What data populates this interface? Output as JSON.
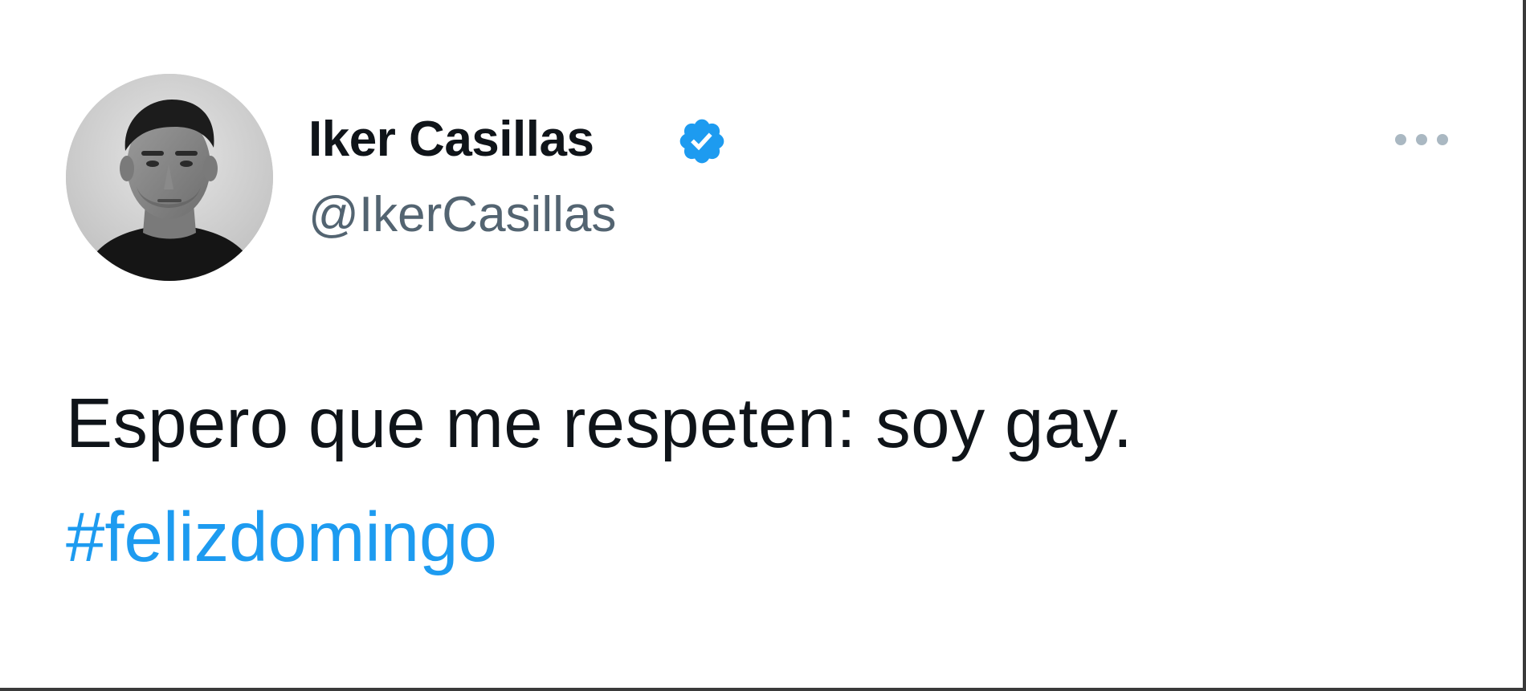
{
  "tweet": {
    "author": {
      "display_name": "Iker Casillas",
      "handle": "@IkerCasillas",
      "verified": true,
      "avatar_icon": "profile-photo"
    },
    "text": "Espero que me respeten: soy gay.",
    "hashtag": "#felizdomingo",
    "more_icon": "more-horizontal-icon",
    "badge_icon": "verified-badge-icon"
  },
  "colors": {
    "text_primary": "#0f1419",
    "text_secondary": "#536471",
    "accent": "#1d9bf0",
    "background": "#ffffff"
  }
}
